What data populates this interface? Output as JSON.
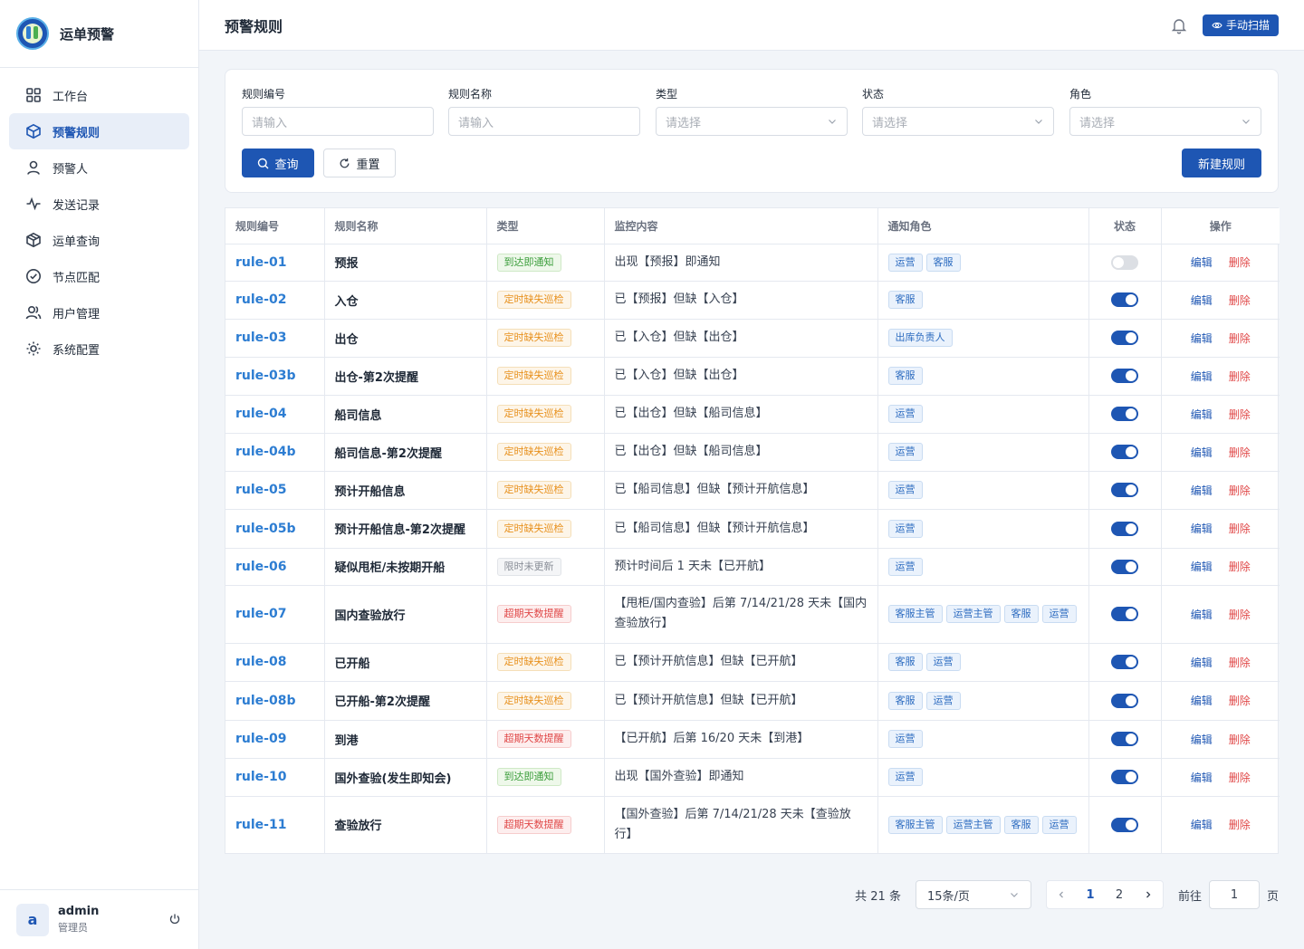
{
  "app": {
    "title": "运单预警"
  },
  "sidebar": {
    "items": [
      {
        "label": "工作台",
        "icon": "dashboard-icon",
        "active": false
      },
      {
        "label": "预警规则",
        "icon": "cube-icon",
        "active": true
      },
      {
        "label": "预警人",
        "icon": "user-icon",
        "active": false
      },
      {
        "label": "发送记录",
        "icon": "activity-icon",
        "active": false
      },
      {
        "label": "运单查询",
        "icon": "box-icon",
        "active": false
      },
      {
        "label": "节点匹配",
        "icon": "check-circle-icon",
        "active": false
      },
      {
        "label": "用户管理",
        "icon": "users-icon",
        "active": false
      },
      {
        "label": "系统配置",
        "icon": "sun-gear-icon",
        "active": false
      }
    ]
  },
  "user": {
    "avatar": "a",
    "name": "admin",
    "role": "管理员"
  },
  "header": {
    "title": "预警规则",
    "scan_label": "手动扫描"
  },
  "filters": {
    "rule_id": {
      "label": "规则编号",
      "placeholder": "请输入"
    },
    "rule_name": {
      "label": "规则名称",
      "placeholder": "请输入"
    },
    "type": {
      "label": "类型",
      "placeholder": "请选择"
    },
    "status": {
      "label": "状态",
      "placeholder": "请选择"
    },
    "role": {
      "label": "角色",
      "placeholder": "请选择"
    },
    "query_label": "查询",
    "reset_label": "重置",
    "new_label": "新建规则"
  },
  "table": {
    "columns": [
      "规则编号",
      "规则名称",
      "类型",
      "监控内容",
      "通知角色",
      "状态",
      "操作"
    ],
    "edit_label": "编辑",
    "delete_label": "删除",
    "rows": [
      {
        "id": "rule-01",
        "name": "预报",
        "type": "到达即通知",
        "type_color": "green",
        "monitor": "出现【预报】即通知",
        "roles": [
          "运营",
          "客服"
        ],
        "enabled": false
      },
      {
        "id": "rule-02",
        "name": "入仓",
        "type": "定时缺失巡检",
        "type_color": "orange",
        "monitor": "已【预报】但缺【入仓】",
        "roles": [
          "客服"
        ],
        "enabled": true
      },
      {
        "id": "rule-03",
        "name": "出仓",
        "type": "定时缺失巡检",
        "type_color": "orange",
        "monitor": "已【入仓】但缺【出仓】",
        "roles": [
          "出库负责人"
        ],
        "enabled": true
      },
      {
        "id": "rule-03b",
        "name": "出仓-第2次提醒",
        "type": "定时缺失巡检",
        "type_color": "orange",
        "monitor": "已【入仓】但缺【出仓】",
        "roles": [
          "客服"
        ],
        "enabled": true
      },
      {
        "id": "rule-04",
        "name": "船司信息",
        "type": "定时缺失巡检",
        "type_color": "orange",
        "monitor": "已【出仓】但缺【船司信息】",
        "roles": [
          "运营"
        ],
        "enabled": true
      },
      {
        "id": "rule-04b",
        "name": "船司信息-第2次提醒",
        "type": "定时缺失巡检",
        "type_color": "orange",
        "monitor": "已【出仓】但缺【船司信息】",
        "roles": [
          "运营"
        ],
        "enabled": true
      },
      {
        "id": "rule-05",
        "name": "预计开船信息",
        "type": "定时缺失巡检",
        "type_color": "orange",
        "monitor": "已【船司信息】但缺【预计开航信息】",
        "roles": [
          "运营"
        ],
        "enabled": true
      },
      {
        "id": "rule-05b",
        "name": "预计开船信息-第2次提醒",
        "type": "定时缺失巡检",
        "type_color": "orange",
        "monitor": "已【船司信息】但缺【预计开航信息】",
        "roles": [
          "运营"
        ],
        "enabled": true
      },
      {
        "id": "rule-06",
        "name": "疑似甩柜/未按期开船",
        "type": "限时未更新",
        "type_color": "gray",
        "monitor": "预计时间后 1 天未【已开航】",
        "roles": [
          "运营"
        ],
        "enabled": true
      },
      {
        "id": "rule-07",
        "name": "国内查验放行",
        "type": "超期天数提醒",
        "type_color": "red",
        "monitor": "【甩柜/国内查验】后第 7/14/21/28 天未【国内查验放行】",
        "roles": [
          "客服主管",
          "运营主管",
          "客服",
          "运营"
        ],
        "enabled": true
      },
      {
        "id": "rule-08",
        "name": "已开船",
        "type": "定时缺失巡检",
        "type_color": "orange",
        "monitor": "已【预计开航信息】但缺【已开航】",
        "roles": [
          "客服",
          "运营"
        ],
        "enabled": true
      },
      {
        "id": "rule-08b",
        "name": "已开船-第2次提醒",
        "type": "定时缺失巡检",
        "type_color": "orange",
        "monitor": "已【预计开航信息】但缺【已开航】",
        "roles": [
          "客服",
          "运营"
        ],
        "enabled": true
      },
      {
        "id": "rule-09",
        "name": "到港",
        "type": "超期天数提醒",
        "type_color": "red",
        "monitor": "【已开航】后第 16/20 天未【到港】",
        "roles": [
          "运营"
        ],
        "enabled": true
      },
      {
        "id": "rule-10",
        "name": "国外查验(发生即知会)",
        "type": "到达即通知",
        "type_color": "green",
        "monitor": "出现【国外查验】即通知",
        "roles": [
          "运营"
        ],
        "enabled": true
      },
      {
        "id": "rule-11",
        "name": "查验放行",
        "type": "超期天数提醒",
        "type_color": "red",
        "monitor": "【国外查验】后第 7/14/21/28 天未【查验放行】",
        "roles": [
          "客服主管",
          "运营主管",
          "客服",
          "运营"
        ],
        "enabled": true
      }
    ]
  },
  "pagination": {
    "total_label": "共 21 条",
    "page_size": "15条/页",
    "pages": [
      "1",
      "2"
    ],
    "current_page": "1",
    "goto_label": "前往",
    "goto_value": "1",
    "goto_suffix": "页"
  },
  "colors": {
    "primary": "#1e56b3",
    "link": "#2d7dd2",
    "danger": "#e04848"
  }
}
